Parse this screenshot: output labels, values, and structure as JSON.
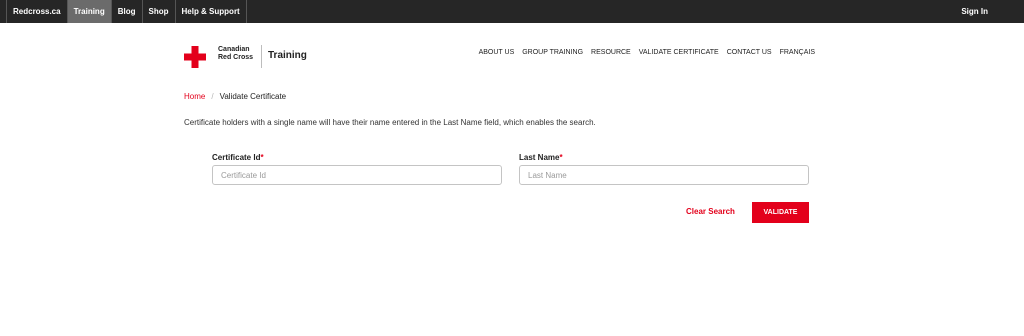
{
  "topbar": {
    "items": [
      {
        "label": "Redcross.ca"
      },
      {
        "label": "Training",
        "active": true
      },
      {
        "label": "Blog"
      },
      {
        "label": "Shop"
      },
      {
        "label": "Help & Support"
      }
    ],
    "sign_in": "Sign In",
    "background_color": "#262626",
    "active_color": "#6b6b6b"
  },
  "header": {
    "org_line1": "Canadian",
    "org_line2": "Red Cross",
    "title": "Training",
    "logo_icon": "red-cross-icon",
    "nav": [
      "ABOUT US",
      "GROUP TRAINING",
      "RESOURCE",
      "VALIDATE CERTIFICATE",
      "CONTACT US",
      "FRANÇAIS"
    ]
  },
  "breadcrumb": {
    "home": "Home",
    "separator": "/",
    "current": "Validate Certificate"
  },
  "intro": "Certificate holders with a single name will have their name entered in the Last Name field, which enables the search.",
  "form": {
    "certificate_id": {
      "label": "Certificate Id",
      "required_mark": "*",
      "placeholder": "Certificate Id",
      "value": ""
    },
    "last_name": {
      "label": "Last Name",
      "required_mark": "*",
      "placeholder": "Last Name",
      "value": ""
    },
    "clear_label": "Clear Search",
    "validate_label": "VALIDATE"
  },
  "colors": {
    "brand_red": "#e3001b"
  }
}
